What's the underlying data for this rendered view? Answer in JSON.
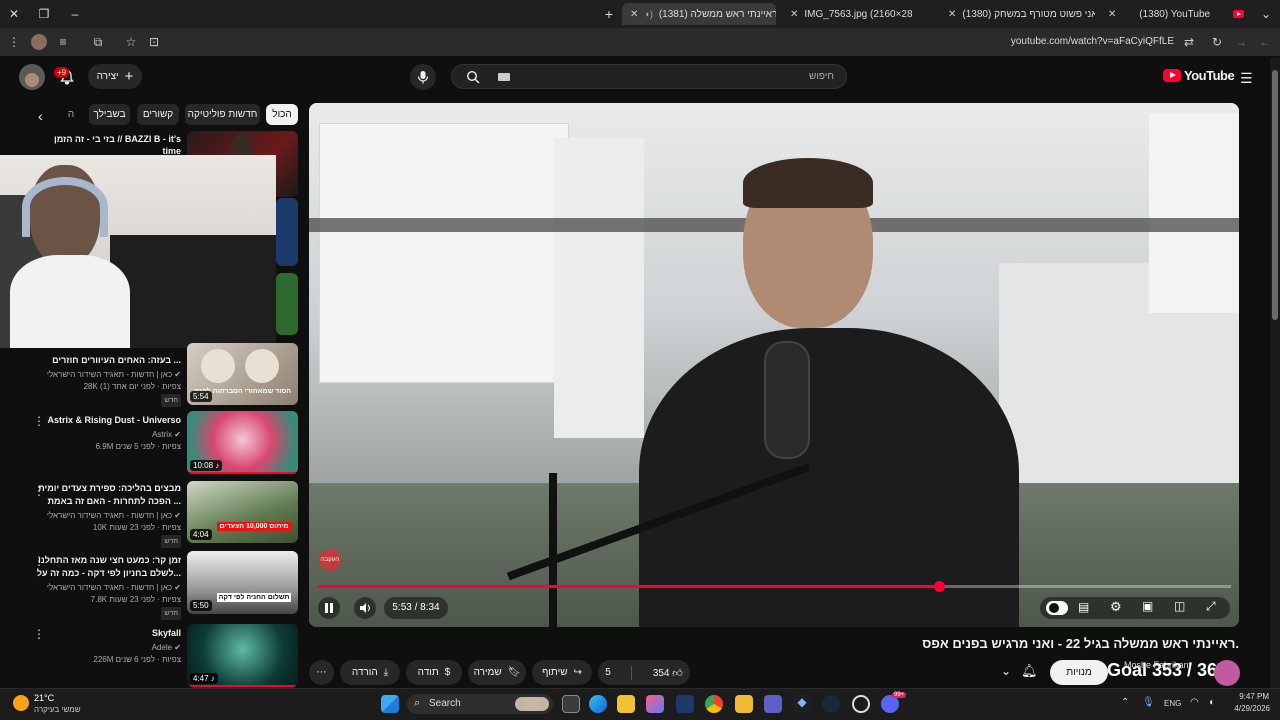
{
  "tabs": [
    {
      "title": "(1380) YouTube",
      "active": false
    },
    {
      "title": "אני פשוט מטורף במשחק",
      "count": "(1380)",
      "active": false
    },
    {
      "title": "IMG_7563.jpg (2160×2880)",
      "active": false
    },
    {
      "title": "ראיינתי ראש ממשלה",
      "count": "(1381)",
      "active": true
    }
  ],
  "address": {
    "url": "youtube.com/watch?v=aFaCyiQFfLE"
  },
  "header": {
    "search_placeholder": "חיפוש",
    "create_label": "יצירה",
    "notif_count": "+9",
    "logo_text": "YouTube"
  },
  "chips": [
    "הכול",
    "חדשות פוליטיקה",
    "קשורים",
    "בשבילך",
    "ה"
  ],
  "sidebar_videos": [
    {
      "title_line1": "בזי בי - זה הזמן // BAZZI B - it's",
      "title_line2": "time"
    },
    {
      "title_line1": "בעזה: האחים העיוורים חוזרים ...",
      "channel": "כאן | חדשות - תאגיד השידור הישראלי",
      "meta": "28K צפיות · לפני יום אחד (1)",
      "badge": "חדש",
      "thumb_text": "הסוד שמאחורי הסברחות לקרב",
      "duration": "5:54"
    },
    {
      "title_line1": "Astrix & Rising Dust - Universo",
      "channel": "Astrix",
      "meta": "6.9M צפיות · לפני 5 שנים",
      "duration": "10:08"
    },
    {
      "title_line1": "מבצים בהליכה: ספירת צעדים יומית",
      "title_line2": "הפכה לתחרות - האם זה באמת ...",
      "channel": "כאן | חדשות - תאגיד השידור הישראלי",
      "meta": "10K צפיות · לפני 23 שעות",
      "badge": "חדש",
      "thumb_text": "מיתוס 10,000 הצעדים",
      "duration": "4:04"
    },
    {
      "title_line1": "זמן קר: כמעט חצי שנה מאז התחלנו",
      "title_line2": "לשלם בחניון לפי דקה - כמה זה על...",
      "channel": "כאן | חדשות - תאגיד השידור הישראלי",
      "meta": "7.8K צפיות · לפני 23 שעות",
      "badge": "חדש",
      "thumb_text": "תשלום החניה לפי דקה",
      "duration": "5:50"
    },
    {
      "title_line1": "Skyfall",
      "channel": "Adele",
      "meta": "226M צפיות · לפני 6 שנים",
      "duration": "4:47"
    }
  ],
  "player": {
    "time_current": "5:53",
    "time_total": "8:34",
    "time_display": "5:53 / 8:34",
    "progress": 0.68,
    "overlay_label": "העקבה"
  },
  "video": {
    "title": "ראיינתי ראש ממשלה בגיל 22 - ואני מרגיש בפנים אפס.",
    "channel": "Moshe Fabrikant",
    "subscribe_label": "מנויות",
    "overlay_watermark": "Goal 353 / 365"
  },
  "actions": {
    "likes": "354",
    "dislikes": "5",
    "share": "שיתוף",
    "save": "שמירה",
    "thanks": "תודה",
    "download": "הורדה"
  },
  "taskbar": {
    "weather_temp": "21°C",
    "weather_desc": "שמשי בעיקרה",
    "search_label": "Search",
    "lang": "ENG",
    "time": "9:47 PM",
    "date": "4/29/2026",
    "notif_badge": "99+"
  }
}
